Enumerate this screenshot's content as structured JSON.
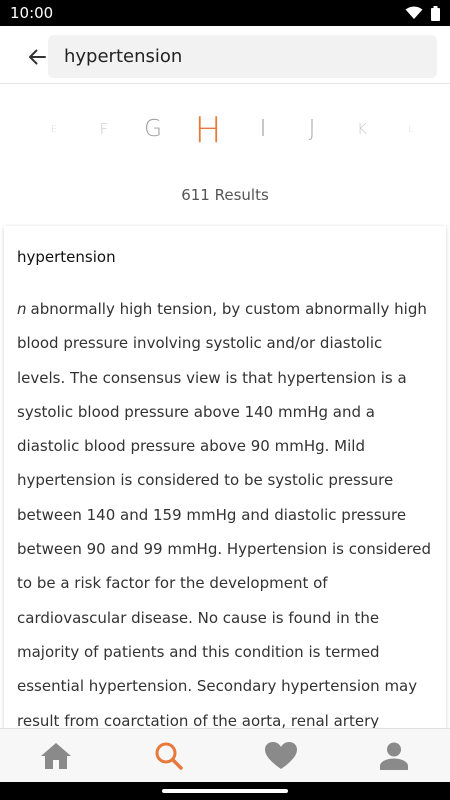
{
  "status_bar": {
    "time": "10:00",
    "icons": [
      "wifi-icon",
      "battery-icon"
    ]
  },
  "header": {
    "back_icon": "arrow-left-icon",
    "search_value": "hypertension"
  },
  "alphabet": {
    "letters": [
      "E",
      "F",
      "G",
      "H",
      "I",
      "J",
      "K",
      "L"
    ],
    "selected": "H",
    "accent_color": "#e8793a"
  },
  "results": {
    "count_text": "611 Results"
  },
  "entry": {
    "term": "hypertension",
    "part_of_speech": "n",
    "definition": "abnormally high tension, by custom abnormally high blood pressure involving systolic and/or diastolic levels. The consensus view is that hypertension is a systolic blood pressure above 140 mmHg and a diastolic blood pressure above 90 mmHg. Mild hypertension is considered to be systolic pressure between 140 and 159 mmHg and diastolic pressure between 90 and 99 mmHg. Hypertension is considered to be a risk factor for the development of cardiovascular disease. No cause is found in the majority of patients and this condition is termed essential hypertension. Secondary hypertension may result from coarctation of the aorta, renal artery stenosis, renal disease, phaeochromocytoma, Cushing's"
  },
  "bottom_nav": {
    "items": [
      {
        "icon": "home-icon",
        "active": false
      },
      {
        "icon": "search-icon",
        "active": true
      },
      {
        "icon": "heart-icon",
        "active": false
      },
      {
        "icon": "person-icon",
        "active": false
      }
    ],
    "active_color": "#e8793a",
    "inactive_color": "#8a8a8a"
  }
}
